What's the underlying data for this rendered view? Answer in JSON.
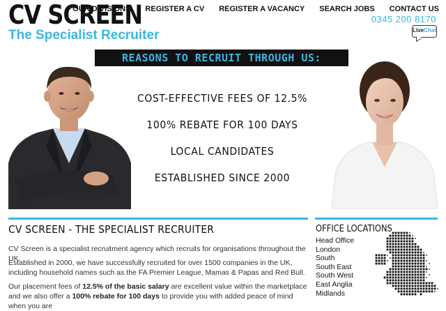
{
  "header": {
    "logo_title": "CV SCREEN",
    "logo_subtitle": "The Specialist Recruiter",
    "nav": [
      "OUR DIVISIONS",
      "REGISTER A CV",
      "REGISTER A VACANCY",
      "SEARCH JOBS",
      "CONTACT US"
    ],
    "phone": "0345 200 8170",
    "livechat_live": "Live",
    "livechat_chat": "Chat"
  },
  "hero": {
    "banner": "REASONS TO RECRUIT THROUGH US:",
    "benefits": [
      "COST-EFFECTIVE FEES OF 12.5%",
      "100% REBATE FOR 100 DAYS",
      "LOCAL CANDIDATES",
      "ESTABLISHED SINCE 2000"
    ]
  },
  "main": {
    "title": "CV SCREEN - THE SPECIALIST RECRUITER",
    "p1": "CV Screen is a specialist recruitment agency which recruits for organisations throughout the UK.",
    "p2": "Established in 2000, we have successfully recruited for over 1500 companies in the UK, including household names such as the FA Premier League, Mamas & Papas and Red Bull.",
    "p3_a": "Our placement fees of ",
    "p3_b": "12.5% of the basic salary",
    "p3_c": " are excellent value within the marketplace and we also offer a ",
    "p3_d": "100% rebate for 100 days",
    "p3_e": " to provide you with added peace of mind when you are"
  },
  "sidebar": {
    "title": "OFFICE LOCATIONS",
    "offices": [
      "Head Office",
      "London",
      "South",
      "South East",
      "South West",
      "East Anglia",
      "Midlands"
    ]
  },
  "colors": {
    "accent": "#3cb6e3",
    "dark": "#111111"
  },
  "icons": {
    "livechat": "speech-bubble-icon",
    "map": "uk-map-icon"
  }
}
